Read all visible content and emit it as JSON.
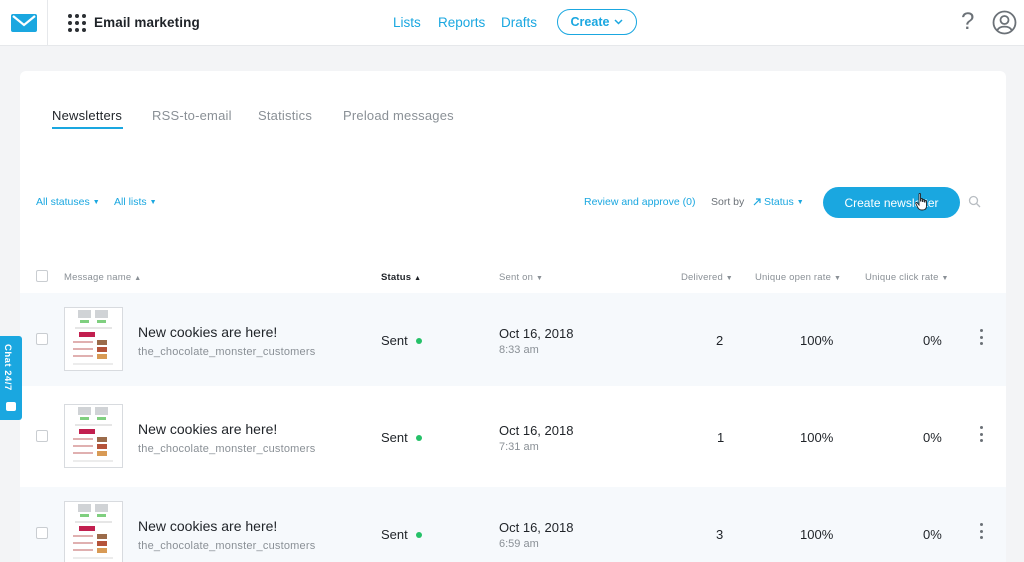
{
  "header": {
    "app_title": "Email marketing",
    "nav": [
      "Lists",
      "Reports",
      "Drafts"
    ],
    "create_label": "Create",
    "help_label": "?"
  },
  "tabs": [
    {
      "label": "Newsletters",
      "active": true
    },
    {
      "label": "RSS-to-email",
      "active": false
    },
    {
      "label": "Statistics",
      "active": false
    },
    {
      "label": "Preload messages",
      "active": false
    }
  ],
  "toolbar": {
    "filter_status": "All statuses",
    "filter_lists": "All lists",
    "review": "Review and approve (0)",
    "sort_label": "Sort by",
    "sort_value": "Status",
    "create_newsletter": "Create newsletter"
  },
  "columns": [
    "Message name",
    "Status",
    "Sent on",
    "Delivered",
    "Unique open rate",
    "Unique click rate"
  ],
  "rows": [
    {
      "name": "New cookies are here!",
      "list": "the_chocolate_monster_customers",
      "status": "Sent",
      "date": "Oct 16, 2018",
      "time": "8:33 am",
      "delivered": "2",
      "open_rate": "100%",
      "click_rate": "0%"
    },
    {
      "name": "New cookies are here!",
      "list": "the_chocolate_monster_customers",
      "status": "Sent",
      "date": "Oct 16, 2018",
      "time": "7:31 am",
      "delivered": "1",
      "open_rate": "100%",
      "click_rate": "0%"
    },
    {
      "name": "New cookies are here!",
      "list": "the_chocolate_monster_customers",
      "status": "Sent",
      "date": "Oct 16, 2018",
      "time": "6:59 am",
      "delivered": "3",
      "open_rate": "100%",
      "click_rate": "0%"
    }
  ],
  "chat": {
    "label": "Chat 24/7"
  },
  "colors": {
    "accent": "#1aa7e0",
    "sent_dot": "#25c168",
    "row_alt": "#f6f9fc"
  },
  "icons": [
    "logo-envelope-icon",
    "apps-grid-icon",
    "chevron-down-icon",
    "help-icon",
    "account-icon",
    "search-icon",
    "kebab-menu-icon",
    "chat-bubble-icon"
  ]
}
